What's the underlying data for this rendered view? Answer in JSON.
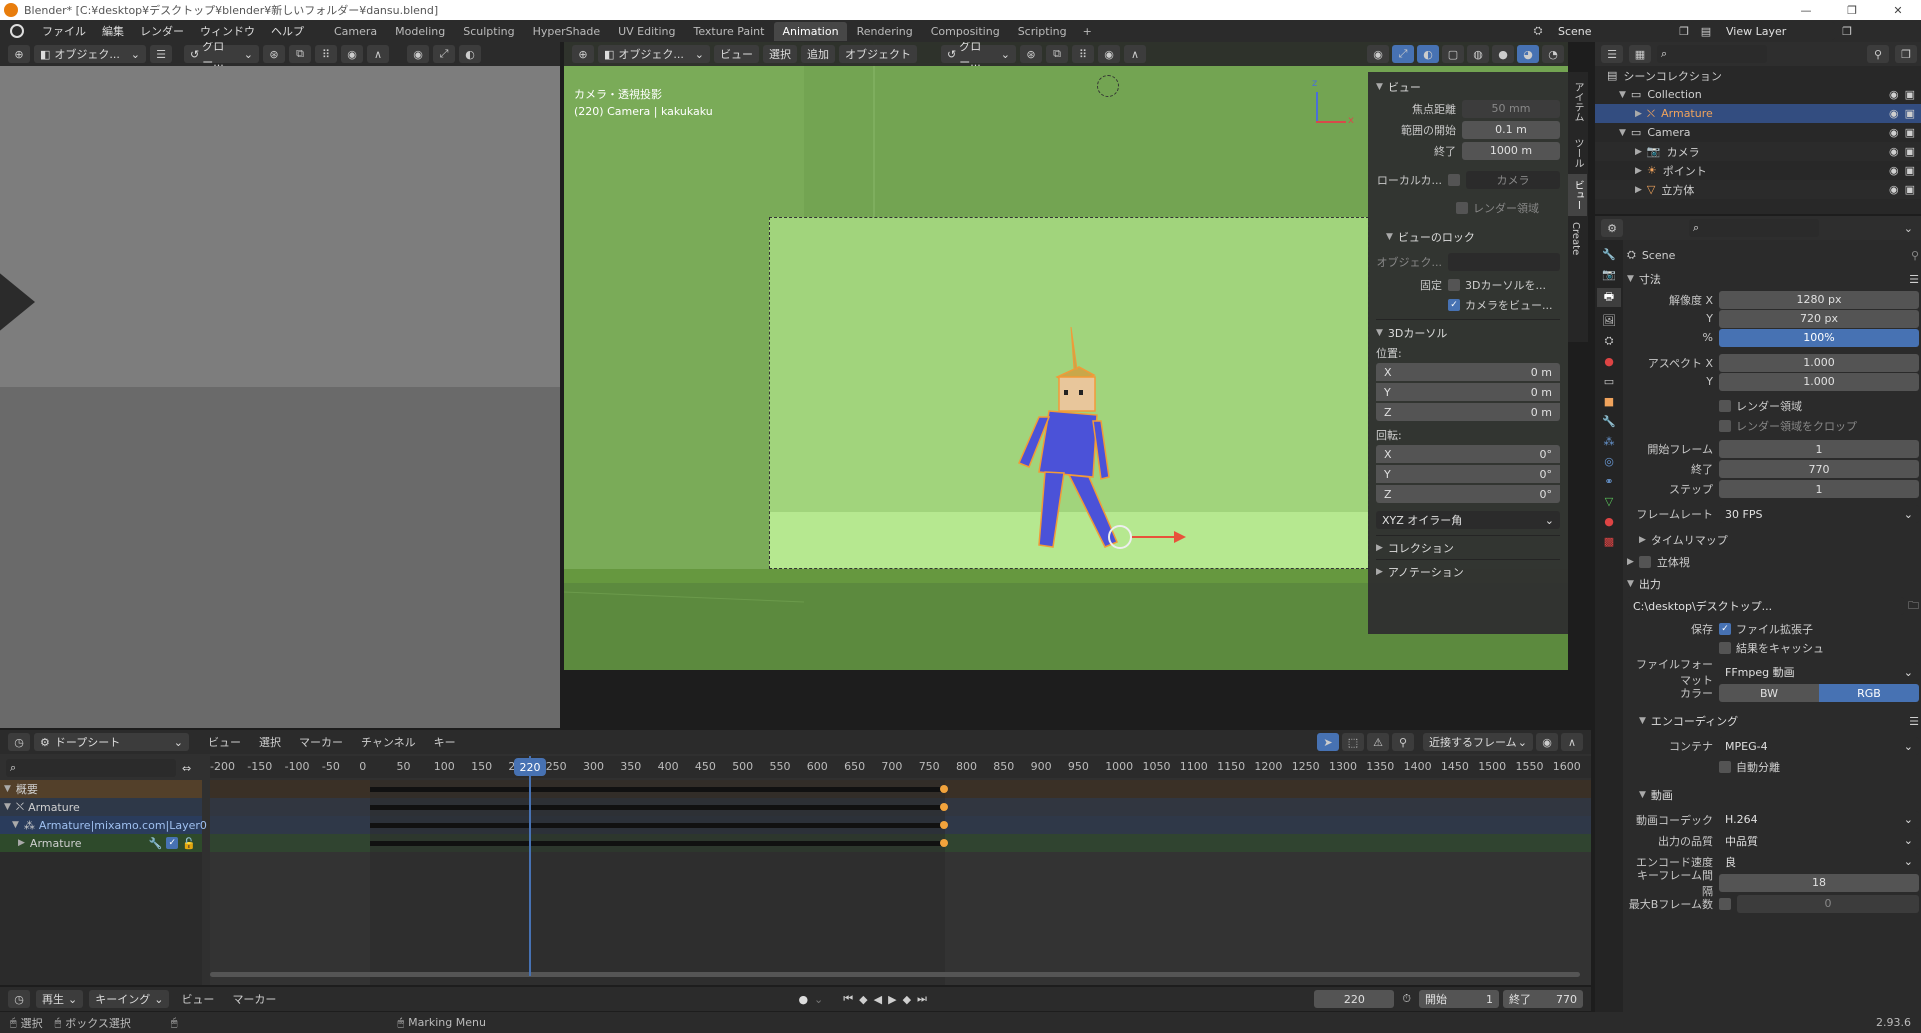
{
  "window": {
    "title": "Blender* [C:¥desktop¥デスクトップ¥blender¥新しいフォルダー¥dansu.blend]",
    "controls": [
      "—",
      "❐",
      "✕"
    ]
  },
  "menu": [
    "ファイル",
    "編集",
    "レンダー",
    "ウィンドウ",
    "ヘルプ"
  ],
  "workspaces": [
    "Camera",
    "Modeling",
    "Sculpting",
    "HyperShade",
    "UV Editing",
    "Texture Paint",
    "Animation",
    "Rendering",
    "Compositing",
    "Scripting"
  ],
  "active_workspace": "Animation",
  "scene_name": "Scene",
  "view_layer": "View Layer",
  "left_header": {
    "mode": "オブジェク...",
    "transform": "グロー..."
  },
  "viewport": {
    "header": {
      "mode": "オブジェク...",
      "menus": [
        "ビュー",
        "選択",
        "追加",
        "オブジェクト"
      ],
      "transform": "グロー..."
    },
    "info_line1": "カメラ・透視投影",
    "info_line2": "(220) Camera | kakukaku",
    "gizmo": {
      "x": "x",
      "z": "z"
    }
  },
  "npanel": {
    "tabs": [
      "アイテム",
      "ツール",
      "ビュー",
      "Create"
    ],
    "view_title": "ビュー",
    "focal_label": "焦点距離",
    "focal_value": "50 mm",
    "clip_start_label": "範囲の開始",
    "clip_start_value": "0.1 m",
    "clip_end_label": "終了",
    "clip_end_value": "1000 m",
    "local_camera_label": "ローカルカ...",
    "local_camera_value": "カメラ",
    "render_region": "レンダー領域",
    "view_lock_title": "ビューのロック",
    "lock_object_label": "オブジェク...",
    "lock_label": "固定",
    "lock_cursor": "3Dカーソルを...",
    "lock_camera": "カメラをビュー...",
    "cursor_title": "3Dカーソル",
    "location_label": "位置:",
    "loc": [
      {
        "axis": "X",
        "value": "0 m"
      },
      {
        "axis": "Y",
        "value": "0 m"
      },
      {
        "axis": "Z",
        "value": "0 m"
      }
    ],
    "rotation_label": "回転:",
    "rot": [
      {
        "axis": "X",
        "value": "0°"
      },
      {
        "axis": "Y",
        "value": "0°"
      },
      {
        "axis": "Z",
        "value": "0°"
      }
    ],
    "rot_mode": "XYZ オイラー角",
    "collection_title": "コレクション",
    "annotation_title": "アノテーション"
  },
  "outliner": {
    "root": "シーンコレクション",
    "items": [
      {
        "name": "Collection",
        "level": 0,
        "icon": "collection-icon"
      },
      {
        "name": "Armature",
        "level": 1,
        "icon": "armature-icon",
        "selected": true
      },
      {
        "name": "Camera",
        "level": 0,
        "icon": "collection-icon"
      },
      {
        "name": "カメラ",
        "level": 1,
        "icon": "camera-icon"
      },
      {
        "name": "ポイント",
        "level": 1,
        "icon": "light-icon"
      },
      {
        "name": "立方体",
        "level": 1,
        "icon": "mesh-icon"
      }
    ]
  },
  "properties": {
    "scene": "Scene",
    "dimensions_title": "寸法",
    "res_x_label": "解像度 X",
    "res_x": "1280 px",
    "res_y_label": "Y",
    "res_y": "720 px",
    "pct_label": "%",
    "pct": "100%",
    "aspect_x_label": "アスペクト X",
    "aspect_x": "1.000",
    "aspect_y_label": "Y",
    "aspect_y": "1.000",
    "render_region": "レンダー領域",
    "crop_region": "レンダー領域をクロップ",
    "frame_start_label": "開始フレーム",
    "frame_start": "1",
    "frame_end_label": "終了",
    "frame_end": "770",
    "frame_step_label": "ステップ",
    "frame_step": "1",
    "fps_label": "フレームレート",
    "fps": "30 FPS",
    "time_remap": "タイムリマップ",
    "stereo": "立体視",
    "output_title": "出力",
    "output_path": "C:\\desktop\\デスクトップ...",
    "save_label": "保存",
    "file_ext": "ファイル拡張子",
    "cache_result": "結果をキャッシュ",
    "file_format_label": "ファイルフォーマット",
    "file_format": "FFmpeg 動画",
    "color_label": "カラー",
    "color_bw": "BW",
    "color_rgb": "RGB",
    "encoding_title": "エンコーディング",
    "container_label": "コンテナ",
    "container": "MPEG-4",
    "autosplit": "自動分離",
    "video_title": "動画",
    "codec_label": "動画コーデック",
    "codec": "H.264",
    "quality_label": "出力の品質",
    "quality": "中品質",
    "speed_label": "エンコード速度",
    "speed": "良",
    "keyframe_label": "キーフレーム間隔",
    "keyframe": "18",
    "bframes_label": "最大Bフレーム数",
    "bframes": "0"
  },
  "dopesheet": {
    "editor": "ドープシート",
    "menus": [
      "ビュー",
      "選択",
      "マーカー",
      "チャンネル",
      "キー"
    ],
    "snap": "近接するフレーム",
    "ruler": [
      "-200",
      "-150",
      "-100",
      "-50",
      "0",
      "50",
      "100",
      "150",
      "200",
      "250",
      "300",
      "350",
      "400",
      "450",
      "500",
      "550",
      "600",
      "650",
      "700",
      "750",
      "800",
      "850",
      "900",
      "950",
      "1000",
      "1050",
      "1100",
      "1150",
      "1200",
      "1250",
      "1300",
      "1350",
      "1400",
      "1450",
      "1500",
      "1550",
      "1600"
    ],
    "current_frame": "220",
    "channels": [
      {
        "name": "概要",
        "type": "summary"
      },
      {
        "name": "Armature",
        "type": "object"
      },
      {
        "name": "Armature|mixamo.com|Layer0",
        "type": "action"
      },
      {
        "name": "Armature",
        "type": "group"
      }
    ]
  },
  "timeline": {
    "menus": [
      "再生",
      "キーイング",
      "ビュー",
      "マーカー"
    ],
    "frame": "220",
    "start_label": "開始",
    "start": "1",
    "end_label": "終了",
    "end": "770"
  },
  "status": {
    "select": "選択",
    "box_select": "ボックス選択",
    "marking": "Marking Menu",
    "version": "2.93.6"
  },
  "colors": {
    "accent": "#4772b3",
    "active_object": "#f0a35c",
    "viewport_green": "#8ebf6b",
    "key_orange": "#f2a33c"
  }
}
